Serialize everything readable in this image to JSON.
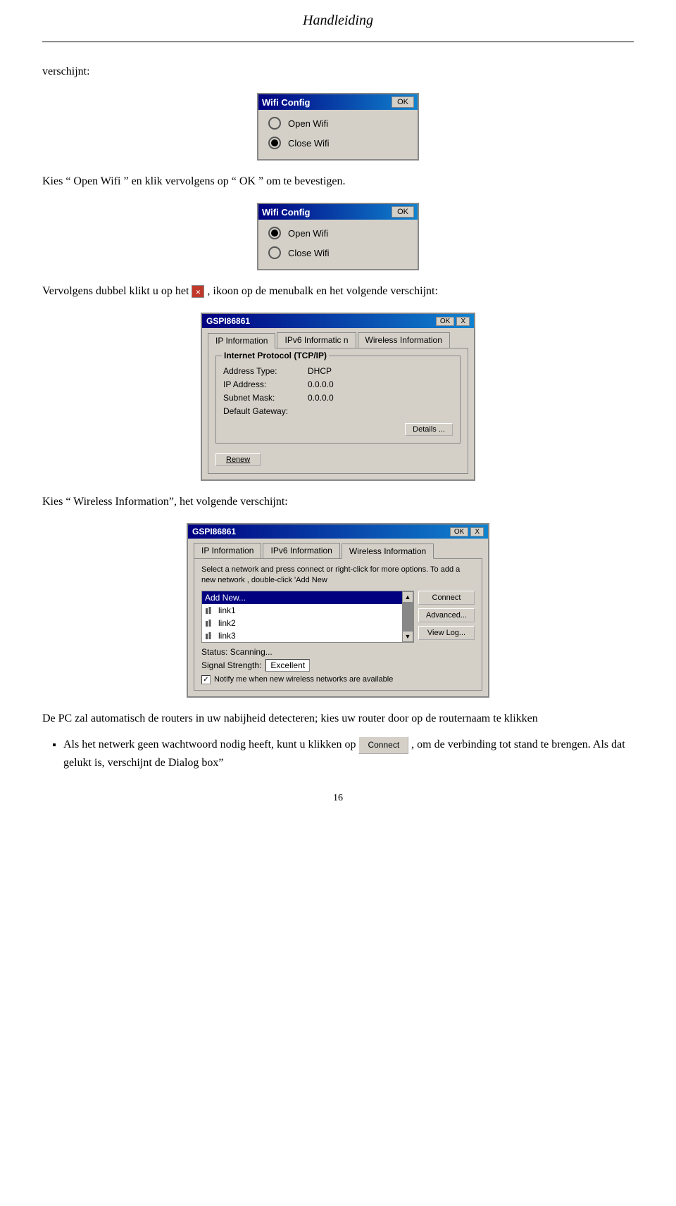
{
  "page": {
    "title": "Handleiding",
    "page_number": "16"
  },
  "sections": {
    "verschijnt_label": "verschijnt:",
    "wifi_dialog_1": {
      "title": "Wifi Config",
      "ok_label": "OK",
      "options": [
        {
          "label": "Open Wifi",
          "selected": false
        },
        {
          "label": "Close Wifi",
          "selected": true
        }
      ]
    },
    "text_after_wifi1": "Kies “ Open Wifi ” en klik vervolgens op “ OK ” om te bevestigen.",
    "wifi_dialog_2": {
      "title": "Wifi Config",
      "ok_label": "OK",
      "options": [
        {
          "label": "Open Wifi",
          "selected": true
        },
        {
          "label": "Close Wifi",
          "selected": false
        }
      ]
    },
    "text_after_wifi2": "Vervolgens dubbel klikt u op het",
    "text_after_wifi2b": ", ikoon op de menubalk en het volgende verschijnt:",
    "gspi_dialog_1": {
      "title": "GSPI86861",
      "ok_label": "OK",
      "close_label": "X",
      "tabs": [
        {
          "label": "IP Information",
          "active": true
        },
        {
          "label": "IPv6 Informatic n",
          "active": false
        },
        {
          "label": "Wireless Information",
          "active": false
        }
      ],
      "group_label": "Internet Protocol (TCP/IP)",
      "fields": [
        {
          "label": "Address Type:",
          "value": "DHCP"
        },
        {
          "label": "IP Address:",
          "value": "0.0.0.0"
        },
        {
          "label": "Subnet Mask:",
          "value": "0.0.0.0"
        },
        {
          "label": "Default Gateway:",
          "value": ""
        }
      ],
      "details_btn": "Details ...",
      "renew_btn": "Renew"
    },
    "text_before_wireless": "Kies “ Wireless Information”, het volgende verschijnt:",
    "gspi_dialog_2": {
      "title": "GSPI86861",
      "ok_label": "OK",
      "close_label": "X",
      "tabs": [
        {
          "label": "IP Information",
          "active": false
        },
        {
          "label": "IPv6 Information",
          "active": false
        },
        {
          "label": "Wireless Information",
          "active": true
        }
      ],
      "instruction": "Select a network and press connect or right-click for more options. To add a new network , double-click 'Add New",
      "networks": [
        {
          "label": "Add New...",
          "selected": true,
          "has_icon": false
        },
        {
          "label": "link1",
          "selected": false,
          "has_icon": true
        },
        {
          "label": "link2",
          "selected": false,
          "has_icon": true
        },
        {
          "label": "link3",
          "selected": false,
          "has_icon": true
        }
      ],
      "action_btns": [
        "Connect",
        "Advanced...",
        "View Log..."
      ],
      "status_label": "Status:",
      "status_value": "Scanning...",
      "signal_label": "Signal Strength:",
      "signal_value": "Excellent",
      "notify_label": "Notify me when new wireless networks are available",
      "notify_checked": true
    },
    "text_after_wireless1": "De PC zal automatisch de routers in uw nabijheid detecteren; kies uw router door op de routernaam te klikken",
    "bullet_items": [
      {
        "text_before": "Als het netwerk geen wachtwoord nodig heeft, kunt u klikken op",
        "btn_label": "Connect",
        "text_after": ", om de verbinding tot stand te brengen. Als dat gelukt is, verschijnt de Dialog box”"
      }
    ]
  }
}
